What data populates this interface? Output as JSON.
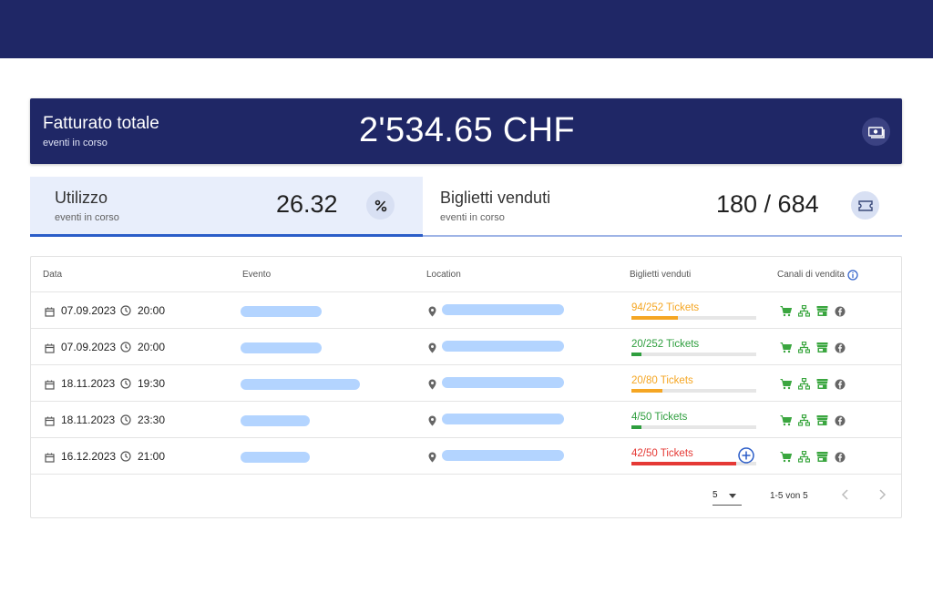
{
  "revenue": {
    "title": "Fatturato totale",
    "subtitle": "eventi in corso",
    "amount": "2'534.65 CHF",
    "icon": "money-icon"
  },
  "utilization": {
    "title": "Utilizzo",
    "subtitle": "eventi in corso",
    "value": "26.32",
    "icon": "percent-icon"
  },
  "tickets_sold": {
    "title": "Biglietti venduti",
    "subtitle": "eventi in corso",
    "value": "180 / 684",
    "icon": "ticket-icon"
  },
  "table": {
    "headers": [
      "Data",
      "Evento",
      "Location",
      "Biglietti venduti",
      "Canali di vendita"
    ],
    "rows": [
      {
        "date": "07.09.2023",
        "time": "20:00",
        "tickets": "94/252 Tickets",
        "fraction": 0.373,
        "status_color": "#f5a623",
        "fill_color": "#f5a623"
      },
      {
        "date": "07.09.2023",
        "time": "20:00",
        "tickets": "20/252 Tickets",
        "fraction": 0.079,
        "status_color": "#2e9e3e",
        "fill_color": "#2e9e3e"
      },
      {
        "date": "18.11.2023",
        "time": "19:30",
        "tickets": "20/80 Tickets",
        "fraction": 0.25,
        "status_color": "#f5a623",
        "fill_color": "#f5a623"
      },
      {
        "date": "18.11.2023",
        "time": "23:30",
        "tickets": "4/50 Tickets",
        "fraction": 0.08,
        "status_color": "#2e9e3e",
        "fill_color": "#2e9e3e"
      },
      {
        "date": "16.12.2023",
        "time": "21:00",
        "tickets": "42/50 Tickets",
        "fraction": 0.84,
        "status_color": "#e53935",
        "fill_color": "#e53935"
      }
    ],
    "channel_icons": [
      "cart-icon",
      "sitemap-icon",
      "store-icon",
      "facebook-icon"
    ]
  },
  "pagination": {
    "per_page": "5",
    "range": "1-5 von 5"
  },
  "colors": {
    "navy": "#1f2766",
    "accent": "#2b5dc8",
    "channel_green": "#3aa63f"
  }
}
